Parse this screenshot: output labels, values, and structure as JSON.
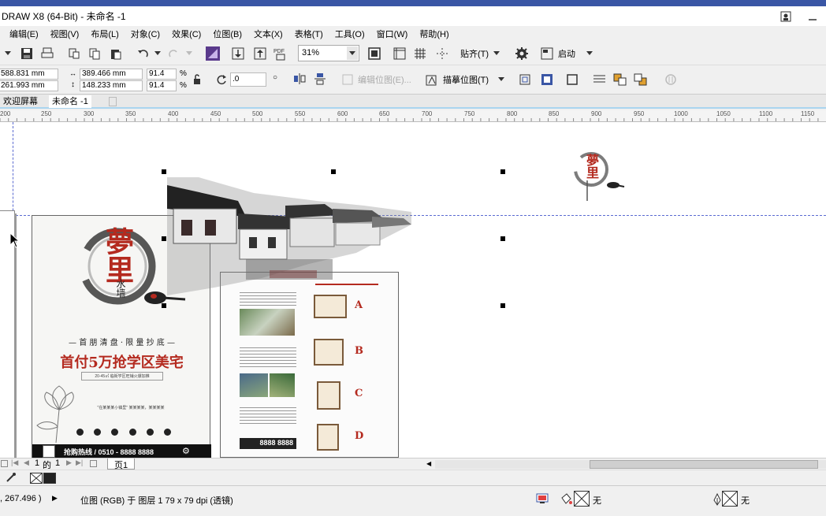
{
  "window": {
    "title": "DRAW X8 (64-Bit) - 未命名 -1"
  },
  "menu": [
    "编辑(E)",
    "视图(V)",
    "布局(L)",
    "对象(C)",
    "效果(C)",
    "位图(B)",
    "文本(X)",
    "表格(T)",
    "工具(O)",
    "窗口(W)",
    "帮助(H)"
  ],
  "toolbar": {
    "zoom": "31%",
    "snap_label": "贴齐(T)",
    "launch_label": "启动"
  },
  "properties": {
    "x": "588.831 mm",
    "y": "261.993 mm",
    "width": "389.466 mm",
    "height": "148.233 mm",
    "scale_x": "91.4",
    "scale_y": "91.4",
    "percent": "%",
    "rotation": ".0",
    "edit_bitmap": "编辑位图(E)...",
    "trace_bitmap": "描摹位图(T)"
  },
  "tabs": [
    "欢迎屏幕",
    "未命名 -1"
  ],
  "ruler": [
    "200",
    "250",
    "300",
    "350",
    "400",
    "450",
    "500",
    "550",
    "600",
    "650",
    "700",
    "750",
    "800",
    "850",
    "900",
    "950",
    "1000",
    "1050",
    "1100",
    "1150"
  ],
  "poster_front": {
    "logo": "夢里",
    "logo_sub": "水墙",
    "tagline": "— 首 朋 清 盘 · 限 量 抄 底 —",
    "headline": "首付5万抢学区美宅",
    "subline": "20-45㎡ 临街学区旺铺火爆加推",
    "quote": "\"在某某某小镇里\" 某某某某，某某某某",
    "hotline": "抢购热线 / 0510 - 8888 8888"
  },
  "poster_back": {
    "section_a": "A",
    "section_b": "B",
    "section_c": "C",
    "section_d": "D",
    "phone": "8888 8888"
  },
  "pager": {
    "current": "1",
    "of": "的",
    "total": "1",
    "page_tab": "页1"
  },
  "status": {
    "coords": ", 267.496 )",
    "info": "位图 (RGB) 于 图层 1 79 x 79 dpi (透镜)",
    "fill_none": "无",
    "outline_none": "无"
  },
  "colors": {
    "accent_red": "#b42a1f",
    "title_blue": "#3a56a5",
    "guide_blue": "#5b6bd1"
  }
}
